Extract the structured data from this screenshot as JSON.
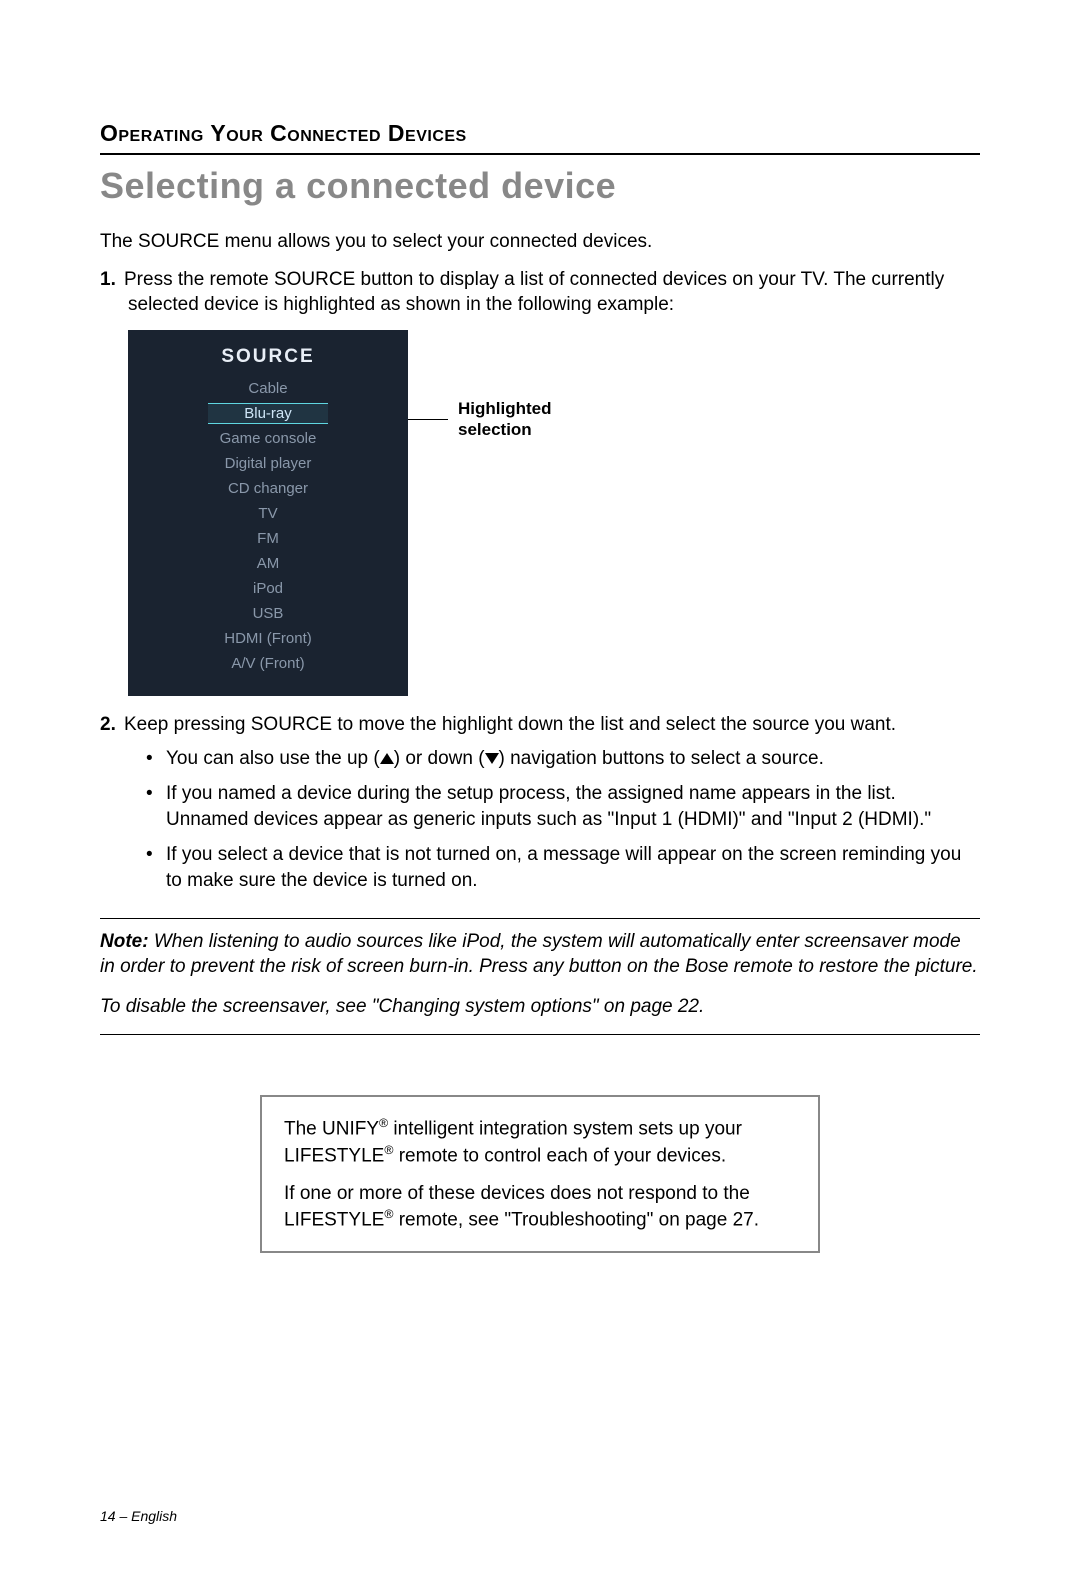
{
  "header": {
    "section": "Operating Your Connected Devices",
    "title": "Selecting a connected device"
  },
  "intro": "The SOURCE menu allows you to select your connected devices.",
  "steps": {
    "s1": {
      "num": "1.",
      "text": "Press the remote SOURCE button to display a list of connected devices on your TV. The currently selected device is highlighted as shown in the following example:"
    },
    "s2": {
      "num": "2.",
      "text": "Keep pressing SOURCE to move the highlight down the list and select the source you want.",
      "bullets": {
        "b1_pre": "You can also use the up (",
        "b1_mid": ") or down (",
        "b1_post": ") navigation buttons to select a source.",
        "b2": "If you named a device during the setup process, the assigned name appears in the list. Unnamed devices appear as generic inputs such as \"Input 1 (HDMI)\" and \"Input 2 (HDMI).\"",
        "b3": "If you select a device that is not turned on, a message will appear on the screen reminding you to make sure the device is turned on."
      }
    }
  },
  "source_menu": {
    "title": "SOURCE",
    "items": [
      "Cable",
      "Blu-ray",
      "Game console",
      "Digital player",
      "CD changer",
      "TV",
      "FM",
      "AM",
      "iPod",
      "USB",
      "HDMI (Front)",
      "A/V (Front)"
    ],
    "highlight_index": 1,
    "callout_line1": "Highlighted",
    "callout_line2": "selection"
  },
  "note": {
    "label": "Note:",
    "text": " When listening to audio sources like iPod, the system will automatically enter screensaver mode in order to prevent the risk of screen burn-in. Press any button on the Bose remote to restore the picture.",
    "disable": "To disable the screensaver, see \"Changing system options\" on page 22."
  },
  "infobox": {
    "p1_a": "The UNIFY",
    "p1_b": " intelligent integration system sets up your LIFESTYLE",
    "p1_c": " remote to control each of your devices.",
    "p2_a": "If one or more of these devices does not respond to the LIFESTYLE",
    "p2_b": " remote, see \"Troubleshooting\" on page 27.",
    "reg": "®"
  },
  "footer": "14 – English"
}
